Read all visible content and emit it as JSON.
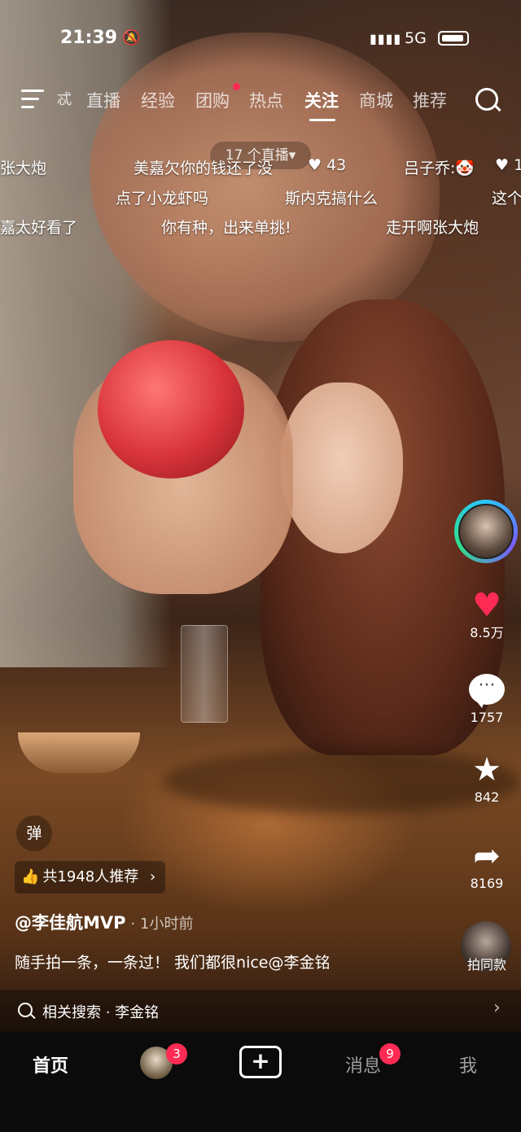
{
  "status_bar": {
    "time": "21:39",
    "network": "5G"
  },
  "top_tabs": {
    "partial_left": "忒",
    "items": [
      "直播",
      "经验",
      "团购",
      "热点",
      "关注",
      "商城",
      "推荐"
    ],
    "active": "关注"
  },
  "live_pill": "17 个直播▾",
  "danmaku": {
    "row1": [
      "张大炮",
      "美嘉欠你的钱还了没",
      "43",
      "吕子乔:🤡",
      "♥ 1"
    ],
    "row2": [
      "点了小龙虾吗",
      "斯内克搞什么",
      "这个"
    ],
    "row3": [
      "嘉太好看了",
      "你有种，出来单挑!",
      "走开啊张大炮"
    ]
  },
  "sidebar": {
    "likes": "8.5万",
    "comments": "1757",
    "favorites": "842",
    "shares": "8169",
    "remix_label": "拍同款"
  },
  "danmu_toggle": "弹",
  "recommend": {
    "text": "共1948人推荐",
    "arrow": "›"
  },
  "author": {
    "handle": "@李佳航MVP",
    "time_ago": "· 1小时前"
  },
  "caption": "随手拍一条，一条过！ 我们都很nice@李金铭",
  "related_search": {
    "text": "相关搜索 · 李金铭",
    "arrow": "›"
  },
  "bottom_nav": {
    "home": "首页",
    "friends_badge": "3",
    "plus": "+",
    "messages": "消息",
    "messages_badge": "9",
    "me": "我"
  },
  "colors": {
    "accent": "#ff2b54",
    "ring_blue": "#29c6ff",
    "ring_green": "#2fe08a"
  }
}
